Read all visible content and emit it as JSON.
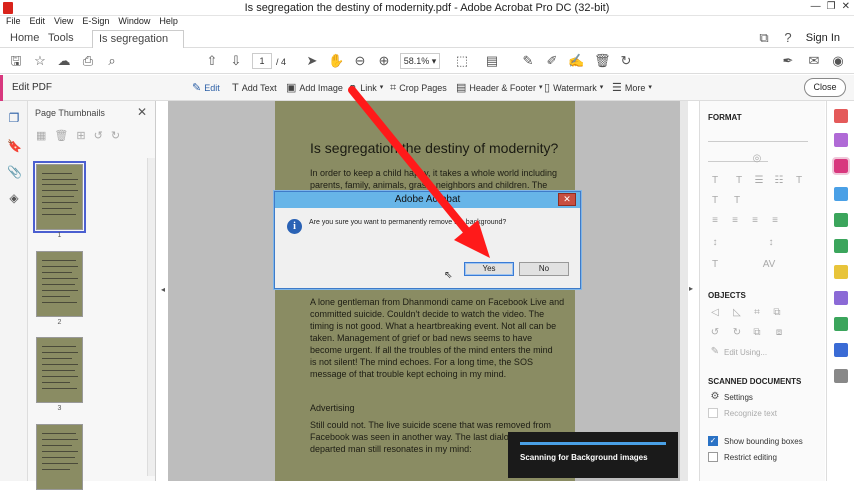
{
  "window": {
    "title": "Is segregation the destiny of modernity.pdf - Adobe Acrobat Pro DC (32-bit)"
  },
  "menu": [
    "File",
    "Edit",
    "View",
    "E-Sign",
    "Window",
    "Help"
  ],
  "tabs": {
    "home": "Home",
    "tools": "Tools",
    "doc": "Is segregation the ...",
    "signin": "Sign In"
  },
  "toolbar": {
    "page_current": "1",
    "page_total": "/ 4",
    "zoom": "58.1%"
  },
  "editbar": {
    "label": "Edit PDF",
    "edit": "Edit",
    "add_text": "Add Text",
    "add_image": "Add Image",
    "link": "Link",
    "crop": "Crop Pages",
    "header_footer": "Header & Footer",
    "watermark": "Watermark",
    "more": "More",
    "close": "Close"
  },
  "thumbnails": {
    "title": "Page Thumbnails",
    "pages": [
      "1",
      "2",
      "3"
    ]
  },
  "document": {
    "title": "Is segregation the destiny of modernity?",
    "para1": [
      "In order to keep a child happy, it takes a whole world including",
      "parents, family, animals, grass, neighbors and children. The"
    ],
    "para2": [
      "A lone gentleman from Dhanmondi came on Facebook Live and",
      "committed suicide. Couldn't decide to watch the video. The",
      "timing is not good. What a heartbreaking event. Not all can be",
      "taken. Management of grief or bad news seems to have",
      "become urgent. If all the troubles of the mind enters the mind",
      "is not silent! The mind echoes. For a long time, the SOS",
      "message of that trouble kept echoing in my mind."
    ],
    "heading": "Advertising",
    "para3": [
      "Still could not. The live suicide scene that was removed from",
      "Facebook was seen in another way. The last dialogue of the",
      "departed man still resonates in my mind:"
    ]
  },
  "dialog": {
    "title": "Adobe Acrobat",
    "message": "Are you sure you want to permanently remove the background?",
    "yes": "Yes",
    "no": "No"
  },
  "right_panel": {
    "format": "FORMAT",
    "objects": "OBJECTS",
    "edit_using": "Edit Using...",
    "scanned": "SCANNED DOCUMENTS",
    "settings": "Settings",
    "recognize": "Recognize text",
    "show_bounding": "Show bounding boxes",
    "restrict": "Restrict editing"
  },
  "progress": {
    "text": "Scanning for Background images",
    "fraction": 1.0
  },
  "colors": {
    "accent": "#d8387e",
    "dialog_title": "#67b5e8",
    "page_bg": "#8a8c63",
    "arrow": "#ff1a1a"
  }
}
